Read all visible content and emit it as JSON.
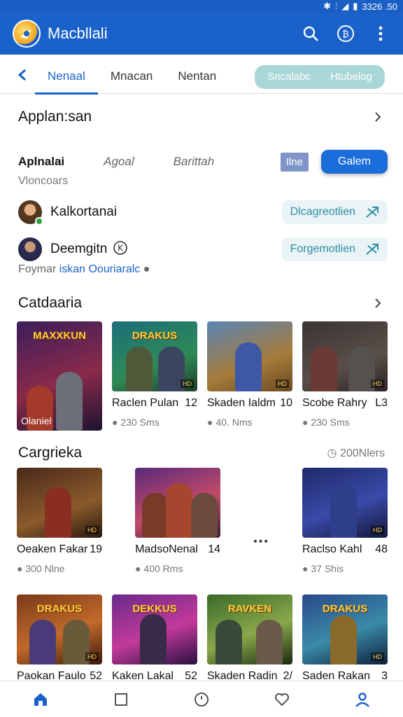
{
  "status_bar": {
    "text": "3326 .50",
    "icons": [
      "bluetooth-icon",
      "vibrate-icon",
      "signal-icon",
      "battery-icon"
    ]
  },
  "app_bar": {
    "title": "Macbllali",
    "icons": [
      "search-icon",
      "currency-icon",
      "more-vert-icon"
    ]
  },
  "tabs": [
    "Nenaal",
    "Mnacan",
    "Nentan"
  ],
  "active_tab": 0,
  "tab_pills": [
    "Sncalabc",
    "Htubelog"
  ],
  "section1": {
    "title": "Applan:san"
  },
  "filters": [
    "Aplnalai",
    "Agoal",
    "Barittah"
  ],
  "filter_mini_btn": "Ilne",
  "filter_primary_btn": "Galem",
  "sub_label": "Vloncoars",
  "users": [
    {
      "name": "Kalkortanai",
      "action": "Dlcagreotlien"
    },
    {
      "name": "Deemgitn",
      "action": "Forgemotlien"
    }
  ],
  "footnote": {
    "prefix": "Foymar",
    "link": "iskan Oouriaralc"
  },
  "section2": {
    "title": "Catdaaria"
  },
  "row1": [
    {
      "thumb_title": "MAXXKUN",
      "caption": "Olaniel",
      "name": "",
      "num": "",
      "meta": ""
    },
    {
      "thumb_title": "DRAKUS",
      "name": "Raclen Pulan",
      "num": "12",
      "meta": "230 Sms"
    },
    {
      "thumb_title": "",
      "name": "Skaden Ialdm",
      "num": "10",
      "meta": "40. Nms"
    },
    {
      "thumb_title": "",
      "name": "Scobe Rahry",
      "num": "L3",
      "meta": "230 Sms"
    }
  ],
  "section3": {
    "title": "Cargrieka",
    "meta": "200Nlers"
  },
  "row2": [
    {
      "name": "Oeaken Fakar",
      "num": "19",
      "meta": "300 Nlne"
    },
    {
      "name": "MadsoNenal",
      "num": "14",
      "meta": "400 Rms"
    },
    {
      "name": "Raclso Kahl",
      "num": "48",
      "meta": "37 Shis"
    }
  ],
  "row2_more": "•••",
  "row3": [
    {
      "thumb_title": "DRAKUS",
      "name": "Paokan Faulo",
      "num": "52"
    },
    {
      "thumb_title": "DEKKUS",
      "name": "Kaken Lakal",
      "num": "52"
    },
    {
      "thumb_title": "RAVKEN",
      "name": "Skaden Radin",
      "num": "2/"
    },
    {
      "thumb_title": "DRAKUS",
      "name": "Saden Rakan",
      "num": "3"
    }
  ],
  "bottom_nav": [
    "home-icon",
    "square-icon",
    "clock-icon",
    "heart-icon",
    "profile-icon"
  ],
  "colors": {
    "primary": "#1a62c9",
    "accent_teal": "#2e8ea3",
    "pill_bg": "#a9d7d8"
  }
}
